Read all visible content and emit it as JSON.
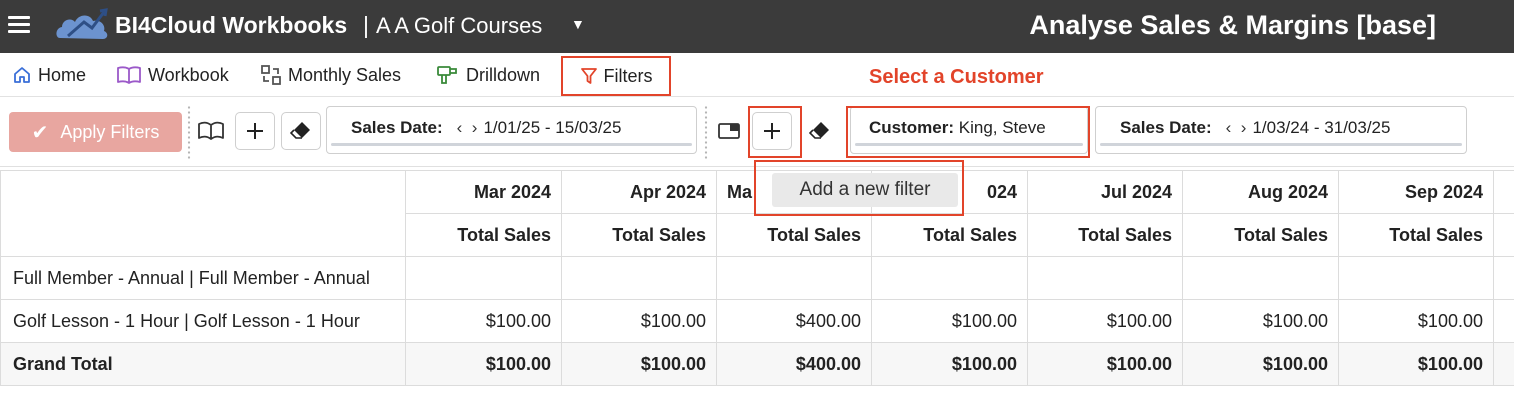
{
  "header": {
    "app_name": "BI4Cloud Workbooks",
    "separator": "|",
    "company": "A A Golf Courses",
    "page_title": "Analyse Sales & Margins [base]",
    "colors": {
      "bar": "#3b3b3b",
      "logo": "#6c93cf"
    }
  },
  "nav": {
    "tabs": [
      {
        "label": "Home",
        "icon": "home-icon"
      },
      {
        "label": "Workbook",
        "icon": "book-icon"
      },
      {
        "label": "Monthly Sales",
        "icon": "report-icon"
      },
      {
        "label": "Drilldown",
        "icon": "drill-icon"
      },
      {
        "label": "Filters",
        "icon": "filter-icon",
        "active": true
      }
    ]
  },
  "annotation": {
    "select_customer": "Select a Customer",
    "color": "#e2442a"
  },
  "toolbar": {
    "apply_label": "Apply Filters",
    "filters": [
      {
        "name": "Sales Date:",
        "value": "1/01/25 - 15/03/25"
      },
      {
        "name": "Customer:",
        "value": "King, Steve"
      },
      {
        "name": "Sales Date:",
        "value": "1/03/24 - 31/03/25"
      }
    ]
  },
  "tooltip": {
    "text": "Add a new filter"
  },
  "table": {
    "months": [
      "Mar 2024",
      "Apr 2024",
      "Ma",
      "024",
      "Jul 2024",
      "Aug 2024",
      "Sep 2024"
    ],
    "measure": "Total Sales",
    "rows": [
      {
        "label": "Full Member - Annual | Full Member - Annual",
        "values": [
          "",
          "",
          "",
          "",
          "",
          "",
          ""
        ]
      },
      {
        "label": "Golf Lesson - 1 Hour | Golf Lesson - 1 Hour",
        "values": [
          "$100.00",
          "$100.00",
          "$400.00",
          "$100.00",
          "$100.00",
          "$100.00",
          "$100.00"
        ]
      }
    ],
    "total": {
      "label": "Grand Total",
      "values": [
        "$100.00",
        "$100.00",
        "$400.00",
        "$100.00",
        "$100.00",
        "$100.00",
        "$100.00"
      ]
    }
  }
}
